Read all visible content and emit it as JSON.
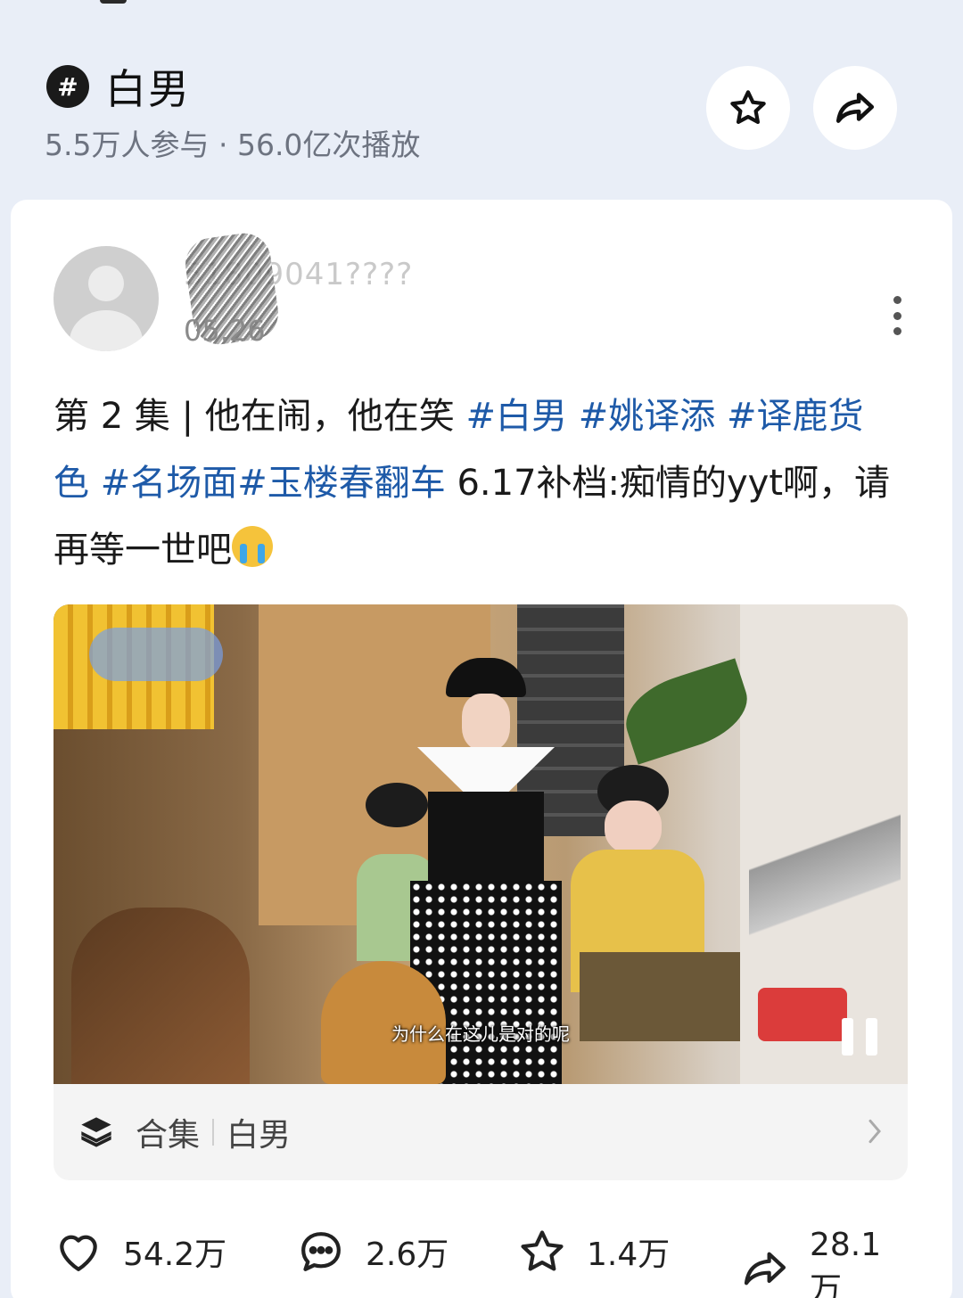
{
  "topic": {
    "hash_glyph": "#",
    "title": "白男",
    "stats": "5.5万人参与 · 56.0亿次播放"
  },
  "post": {
    "username": "51809041????",
    "time": "05.26",
    "text_prefix": "第 2 集 | 他在闹，他在笑 ",
    "tags_line1": [
      "#白男",
      "#姚译添",
      "#译鹿"
    ],
    "tag_continuation": "货色",
    "tags_line2": [
      "#名场面",
      "#玉楼春翻车"
    ],
    "text_suffix": " 6.17补档:痴情的yyt啊，请再等一世吧",
    "emoji": "crying-face",
    "video": {
      "subtitle": "为什么在这儿是对的呢",
      "state": "playing"
    },
    "collection": {
      "label": "合集",
      "name": "白男"
    },
    "actions": {
      "like_count": "54.2万",
      "comment_count": "2.6万",
      "favorite_count": "1.4万",
      "share_count": "28.1万"
    }
  },
  "icons": {
    "favorite": "star-icon",
    "share": "share-arrow-icon",
    "more": "more-vertical-icon",
    "collection": "layers-icon",
    "chevron": "chevron-right-icon",
    "like": "heart-icon",
    "comment": "comment-bubble-icon",
    "pause": "pause-icon"
  },
  "colors": {
    "tag": "#1e5aa8",
    "background": "#e9eef7"
  }
}
